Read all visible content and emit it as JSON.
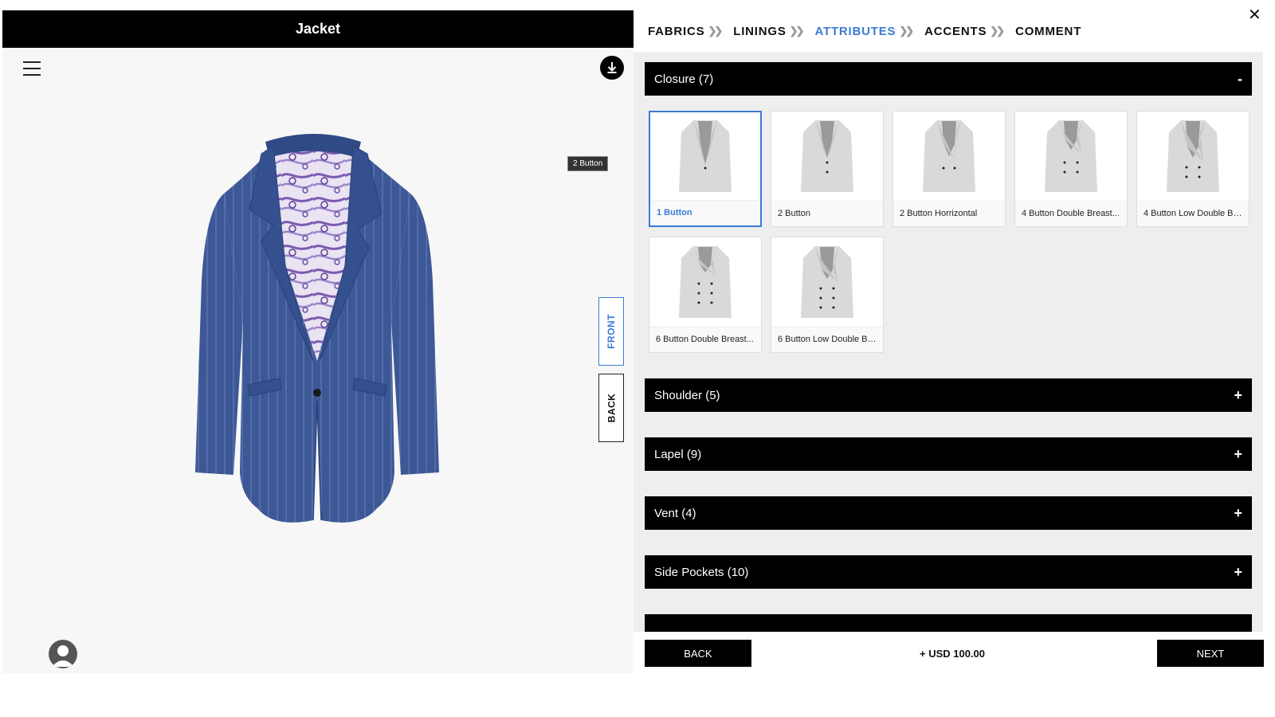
{
  "left": {
    "title": "Jacket",
    "tooltip": "2 Button",
    "view_front": "FRONT",
    "view_back": "BACK"
  },
  "tabs": [
    {
      "label": "FABRICS",
      "active": false
    },
    {
      "label": "LININGS",
      "active": false
    },
    {
      "label": "ATTRIBUTES",
      "active": true
    },
    {
      "label": "ACCENTS",
      "active": false
    },
    {
      "label": "COMMENT",
      "active": false
    }
  ],
  "sections": {
    "closure": {
      "label": "Closure (7)",
      "toggle": "-"
    },
    "shoulder": {
      "label": "Shoulder (5)",
      "toggle": "+"
    },
    "lapel": {
      "label": "Lapel (9)",
      "toggle": "+"
    },
    "vent": {
      "label": "Vent (4)",
      "toggle": "+"
    },
    "side_pockets": {
      "label": "Side Pockets (10)",
      "toggle": "+"
    }
  },
  "closure_options": [
    {
      "label": "1 Button",
      "selected": true
    },
    {
      "label": "2 Button",
      "selected": false
    },
    {
      "label": "2 Button Horrizontal",
      "selected": false
    },
    {
      "label": "4 Button Double Breast...",
      "selected": false
    },
    {
      "label": "4 Button Low Double Br...",
      "selected": false
    },
    {
      "label": "6 Button Double Breast...",
      "selected": false
    },
    {
      "label": "6 Button Low Double Br...",
      "selected": false
    }
  ],
  "footer": {
    "back": "BACK",
    "price": "+ USD 100.00",
    "next": "NEXT"
  },
  "colors": {
    "accent": "#3a7bd5",
    "jacket": "#3b5797",
    "header_bg": "#000000"
  },
  "icons": {
    "menu": "hamburger-menu-icon",
    "download": "download-icon",
    "close": "close-icon",
    "avatar": "user-avatar-icon"
  }
}
